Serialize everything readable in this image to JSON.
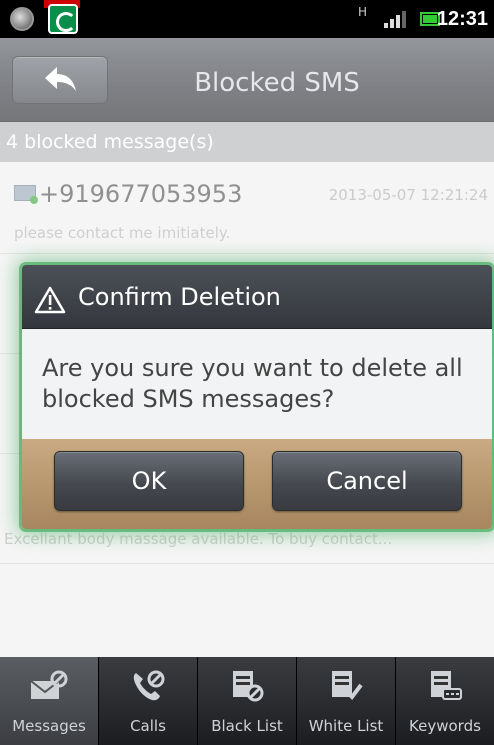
{
  "status_bar": {
    "network_label": "H",
    "time": "12:31"
  },
  "title_bar": {
    "title": "Blocked SMS",
    "back_icon": "back-arrow-icon"
  },
  "list_header": {
    "count_text": "4 blocked message(s)"
  },
  "messages": [
    {
      "sender": "+919677053953",
      "date": "2013-05-07 12:21:24",
      "body": "please contact me imitiately."
    },
    {
      "sender": "",
      "date": "",
      "body": "Excellant body massage available. To buy contact..."
    }
  ],
  "dialog": {
    "title": "Confirm Deletion",
    "icon": "warning-icon",
    "message": "Are you sure you want to delete all blocked SMS messages?",
    "ok_label": "OK",
    "cancel_label": "Cancel",
    "glow_color": "#28a046"
  },
  "bottom_nav": {
    "items": [
      {
        "label": "Messages",
        "icon": "messages-icon"
      },
      {
        "label": "Calls",
        "icon": "phone-icon"
      },
      {
        "label": "Black List",
        "icon": "black-list-icon"
      },
      {
        "label": "White List",
        "icon": "white-list-icon"
      },
      {
        "label": "Keywords",
        "icon": "keywords-icon"
      }
    ]
  }
}
